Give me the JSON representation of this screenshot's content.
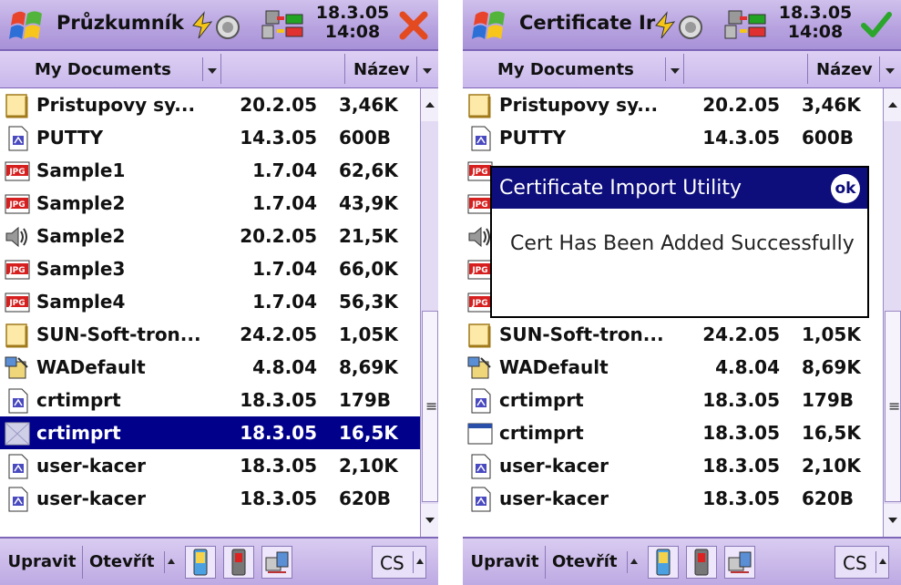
{
  "screens": [
    {
      "title": "Průzkumník",
      "clock": {
        "date": "18.3.05",
        "time": "14:08"
      },
      "corner_button": "close",
      "header": {
        "folder": "My Documents",
        "sort": "Název"
      },
      "files": [
        {
          "icon": "folder-icon",
          "name": "Pristupovy sy...",
          "date": "20.2.05",
          "size": "3,46K"
        },
        {
          "icon": "file-icon",
          "name": "PUTTY",
          "date": "14.3.05",
          "size": "600B"
        },
        {
          "icon": "jpeg-icon",
          "name": "Sample1",
          "date": "1.7.04",
          "size": "62,6K"
        },
        {
          "icon": "jpeg-icon",
          "name": "Sample2",
          "date": "1.7.04",
          "size": "43,9K"
        },
        {
          "icon": "audio-icon",
          "name": "Sample2",
          "date": "20.2.05",
          "size": "21,5K"
        },
        {
          "icon": "jpeg-icon",
          "name": "Sample3",
          "date": "1.7.04",
          "size": "66,0K"
        },
        {
          "icon": "jpeg-icon",
          "name": "Sample4",
          "date": "1.7.04",
          "size": "56,3K"
        },
        {
          "icon": "folder-icon",
          "name": "SUN-Soft-tron...",
          "date": "24.2.05",
          "size": "1,05K"
        },
        {
          "icon": "setup-icon",
          "name": "WADefault",
          "date": "4.8.04",
          "size": "8,69K"
        },
        {
          "icon": "file-icon",
          "name": "crtimprt",
          "date": "18.3.05",
          "size": "179B"
        },
        {
          "icon": "program-icon",
          "name": "crtimprt",
          "date": "18.3.05",
          "size": "16,5K",
          "selected": true
        },
        {
          "icon": "file-icon",
          "name": "user-kacer",
          "date": "18.3.05",
          "size": "2,10K"
        },
        {
          "icon": "file-icon",
          "name": "user-kacer",
          "date": "18.3.05",
          "size": "620B"
        }
      ],
      "bottom": {
        "edit": "Upravit",
        "open": "Otevřít",
        "lang": "CS"
      }
    },
    {
      "title": "Certificate Ir",
      "clock": {
        "date": "18.3.05",
        "time": "14:08"
      },
      "corner_button": "ok",
      "header": {
        "folder": "My Documents",
        "sort": "Název"
      },
      "files": [
        {
          "icon": "folder-icon",
          "name": "Pristupovy sy...",
          "date": "20.2.05",
          "size": "3,46K"
        },
        {
          "icon": "file-icon",
          "name": "PUTTY",
          "date": "14.3.05",
          "size": "600B"
        },
        {
          "icon": "jpeg-icon",
          "name": "",
          "date": "",
          "size": ""
        },
        {
          "icon": "jpeg-icon",
          "name": "",
          "date": "",
          "size": ""
        },
        {
          "icon": "audio-icon",
          "name": "",
          "date": "",
          "size": ""
        },
        {
          "icon": "jpeg-icon",
          "name": "",
          "date": "",
          "size": ""
        },
        {
          "icon": "jpeg-icon",
          "name": "",
          "date": "",
          "size": ""
        },
        {
          "icon": "folder-icon",
          "name": "SUN-Soft-tron...",
          "date": "24.2.05",
          "size": "1,05K"
        },
        {
          "icon": "setup-icon",
          "name": "WADefault",
          "date": "4.8.04",
          "size": "8,69K"
        },
        {
          "icon": "file-icon",
          "name": "crtimprt",
          "date": "18.3.05",
          "size": "179B"
        },
        {
          "icon": "window-icon",
          "name": "crtimprt",
          "date": "18.3.05",
          "size": "16,5K"
        },
        {
          "icon": "file-icon",
          "name": "user-kacer",
          "date": "18.3.05",
          "size": "2,10K"
        },
        {
          "icon": "file-icon",
          "name": "user-kacer",
          "date": "18.3.05",
          "size": "620B"
        }
      ],
      "bottom": {
        "edit": "Upravit",
        "open": "Otevřít",
        "lang": "CS"
      },
      "dialog": {
        "title": "Certificate Import Utility",
        "ok": "ok",
        "message": "Cert Has Been Added Successfully"
      }
    }
  ],
  "colors": {
    "selection": "#00008b",
    "dialog_title": "#0d0d7c",
    "titlebar": "#b8a3e0"
  }
}
